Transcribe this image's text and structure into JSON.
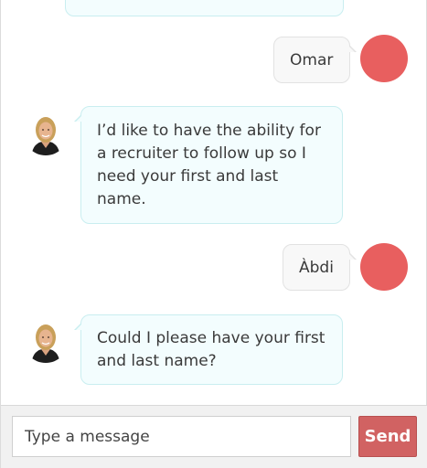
{
  "colors": {
    "bot_bubble_bg": "#f3fdfe",
    "bot_bubble_border": "#c9eef0",
    "user_bubble_bg": "#f8f8f8",
    "user_avatar": "#e85f5f",
    "send_button": "#d16262"
  },
  "transcript": {
    "messages": [
      {
        "sender": "user",
        "text": "Omar"
      },
      {
        "sender": "agent",
        "text": "I’d like to have the ability for a recruiter to follow up so I need your first and last name."
      },
      {
        "sender": "user",
        "text": "Àbdi"
      },
      {
        "sender": "agent",
        "text": "Could I please have your first and last name?"
      }
    ]
  },
  "composer": {
    "placeholder": "Type a message",
    "value": "",
    "send_label": "Send"
  },
  "icons": {
    "agent_avatar": "agent-photo-avatar",
    "user_avatar": "user-avatar-circle"
  }
}
